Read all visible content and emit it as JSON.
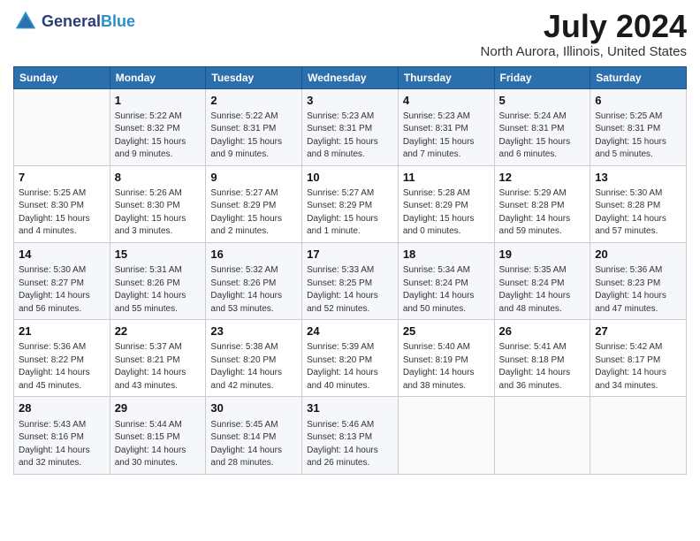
{
  "header": {
    "logo_general": "General",
    "logo_blue": "Blue",
    "month_year": "July 2024",
    "location": "North Aurora, Illinois, United States"
  },
  "days_of_week": [
    "Sunday",
    "Monday",
    "Tuesday",
    "Wednesday",
    "Thursday",
    "Friday",
    "Saturday"
  ],
  "weeks": [
    [
      {
        "day": "",
        "info": ""
      },
      {
        "day": "1",
        "info": "Sunrise: 5:22 AM\nSunset: 8:32 PM\nDaylight: 15 hours\nand 9 minutes."
      },
      {
        "day": "2",
        "info": "Sunrise: 5:22 AM\nSunset: 8:31 PM\nDaylight: 15 hours\nand 9 minutes."
      },
      {
        "day": "3",
        "info": "Sunrise: 5:23 AM\nSunset: 8:31 PM\nDaylight: 15 hours\nand 8 minutes."
      },
      {
        "day": "4",
        "info": "Sunrise: 5:23 AM\nSunset: 8:31 PM\nDaylight: 15 hours\nand 7 minutes."
      },
      {
        "day": "5",
        "info": "Sunrise: 5:24 AM\nSunset: 8:31 PM\nDaylight: 15 hours\nand 6 minutes."
      },
      {
        "day": "6",
        "info": "Sunrise: 5:25 AM\nSunset: 8:31 PM\nDaylight: 15 hours\nand 5 minutes."
      }
    ],
    [
      {
        "day": "7",
        "info": "Sunrise: 5:25 AM\nSunset: 8:30 PM\nDaylight: 15 hours\nand 4 minutes."
      },
      {
        "day": "8",
        "info": "Sunrise: 5:26 AM\nSunset: 8:30 PM\nDaylight: 15 hours\nand 3 minutes."
      },
      {
        "day": "9",
        "info": "Sunrise: 5:27 AM\nSunset: 8:29 PM\nDaylight: 15 hours\nand 2 minutes."
      },
      {
        "day": "10",
        "info": "Sunrise: 5:27 AM\nSunset: 8:29 PM\nDaylight: 15 hours\nand 1 minute."
      },
      {
        "day": "11",
        "info": "Sunrise: 5:28 AM\nSunset: 8:29 PM\nDaylight: 15 hours\nand 0 minutes."
      },
      {
        "day": "12",
        "info": "Sunrise: 5:29 AM\nSunset: 8:28 PM\nDaylight: 14 hours\nand 59 minutes."
      },
      {
        "day": "13",
        "info": "Sunrise: 5:30 AM\nSunset: 8:28 PM\nDaylight: 14 hours\nand 57 minutes."
      }
    ],
    [
      {
        "day": "14",
        "info": "Sunrise: 5:30 AM\nSunset: 8:27 PM\nDaylight: 14 hours\nand 56 minutes."
      },
      {
        "day": "15",
        "info": "Sunrise: 5:31 AM\nSunset: 8:26 PM\nDaylight: 14 hours\nand 55 minutes."
      },
      {
        "day": "16",
        "info": "Sunrise: 5:32 AM\nSunset: 8:26 PM\nDaylight: 14 hours\nand 53 minutes."
      },
      {
        "day": "17",
        "info": "Sunrise: 5:33 AM\nSunset: 8:25 PM\nDaylight: 14 hours\nand 52 minutes."
      },
      {
        "day": "18",
        "info": "Sunrise: 5:34 AM\nSunset: 8:24 PM\nDaylight: 14 hours\nand 50 minutes."
      },
      {
        "day": "19",
        "info": "Sunrise: 5:35 AM\nSunset: 8:24 PM\nDaylight: 14 hours\nand 48 minutes."
      },
      {
        "day": "20",
        "info": "Sunrise: 5:36 AM\nSunset: 8:23 PM\nDaylight: 14 hours\nand 47 minutes."
      }
    ],
    [
      {
        "day": "21",
        "info": "Sunrise: 5:36 AM\nSunset: 8:22 PM\nDaylight: 14 hours\nand 45 minutes."
      },
      {
        "day": "22",
        "info": "Sunrise: 5:37 AM\nSunset: 8:21 PM\nDaylight: 14 hours\nand 43 minutes."
      },
      {
        "day": "23",
        "info": "Sunrise: 5:38 AM\nSunset: 8:20 PM\nDaylight: 14 hours\nand 42 minutes."
      },
      {
        "day": "24",
        "info": "Sunrise: 5:39 AM\nSunset: 8:20 PM\nDaylight: 14 hours\nand 40 minutes."
      },
      {
        "day": "25",
        "info": "Sunrise: 5:40 AM\nSunset: 8:19 PM\nDaylight: 14 hours\nand 38 minutes."
      },
      {
        "day": "26",
        "info": "Sunrise: 5:41 AM\nSunset: 8:18 PM\nDaylight: 14 hours\nand 36 minutes."
      },
      {
        "day": "27",
        "info": "Sunrise: 5:42 AM\nSunset: 8:17 PM\nDaylight: 14 hours\nand 34 minutes."
      }
    ],
    [
      {
        "day": "28",
        "info": "Sunrise: 5:43 AM\nSunset: 8:16 PM\nDaylight: 14 hours\nand 32 minutes."
      },
      {
        "day": "29",
        "info": "Sunrise: 5:44 AM\nSunset: 8:15 PM\nDaylight: 14 hours\nand 30 minutes."
      },
      {
        "day": "30",
        "info": "Sunrise: 5:45 AM\nSunset: 8:14 PM\nDaylight: 14 hours\nand 28 minutes."
      },
      {
        "day": "31",
        "info": "Sunrise: 5:46 AM\nSunset: 8:13 PM\nDaylight: 14 hours\nand 26 minutes."
      },
      {
        "day": "",
        "info": ""
      },
      {
        "day": "",
        "info": ""
      },
      {
        "day": "",
        "info": ""
      }
    ]
  ]
}
